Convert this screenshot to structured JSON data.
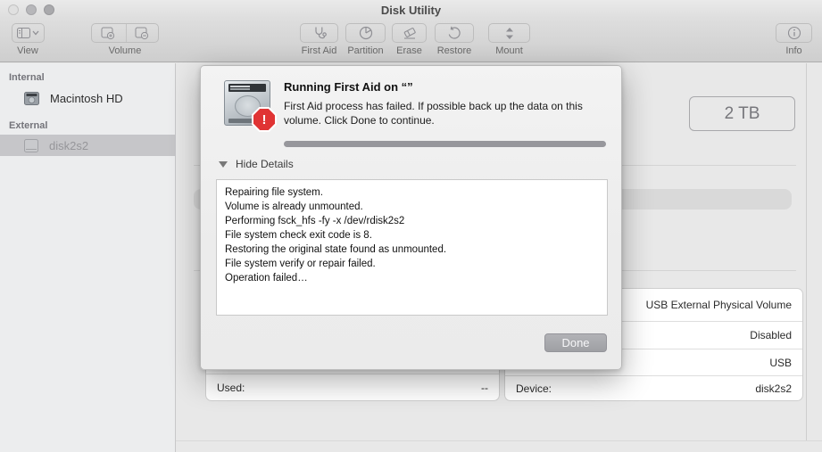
{
  "window": {
    "title": "Disk Utility"
  },
  "toolbar": {
    "view_label": "View",
    "volume_label": "Volume",
    "buttons": [
      {
        "label": "First Aid"
      },
      {
        "label": "Partition"
      },
      {
        "label": "Erase"
      },
      {
        "label": "Restore"
      },
      {
        "label": "Mount"
      }
    ],
    "info_label": "Info"
  },
  "sidebar": {
    "sections": [
      {
        "header": "Internal",
        "items": [
          {
            "label": "Macintosh HD"
          }
        ]
      },
      {
        "header": "External",
        "items": [
          {
            "label": "disk2s2",
            "selected": true
          }
        ]
      }
    ]
  },
  "content": {
    "capacity": "2 TB",
    "left_table": {
      "rows": [
        {
          "label": "Used:",
          "value": "--"
        }
      ]
    },
    "right_table": {
      "rows": [
        {
          "value": "USB External Physical Volume"
        },
        {
          "value": "Disabled"
        },
        {
          "value": "USB"
        },
        {
          "label": "Device:",
          "value": "disk2s2"
        }
      ]
    }
  },
  "dialog": {
    "title": "Running First Aid on “”",
    "message": "First Aid process has failed. If possible back up the data on this volume. Click Done to continue.",
    "details_toggle": "Hide Details",
    "log_lines": [
      "Repairing file system.",
      "Volume is already unmounted.",
      "Performing fsck_hfs -fy -x /dev/rdisk2s2",
      "File system check exit code is 8.",
      "Restoring the original state found as unmounted.",
      "File system verify or repair failed.",
      "Operation failed…"
    ],
    "done_label": "Done"
  },
  "colors": {
    "accent_error": "#e03434",
    "selection_gray": "#c6c6c9",
    "progress_gray": "#97979c"
  }
}
